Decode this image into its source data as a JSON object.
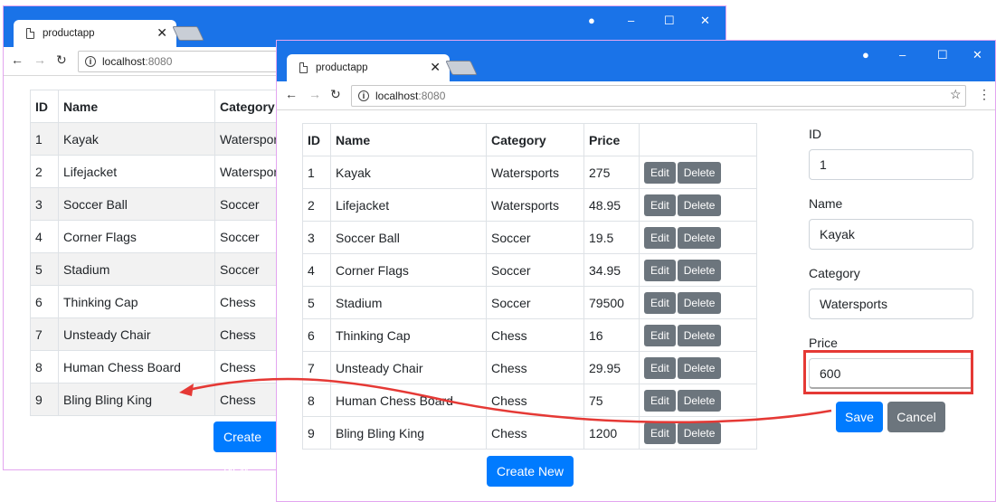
{
  "back_window": {
    "tab_title": "productapp",
    "url_host": "localhost",
    "url_port": ":8080",
    "headers": [
      "ID",
      "Name",
      "Category"
    ],
    "rows": [
      [
        "1",
        "Kayak",
        "Watersports"
      ],
      [
        "2",
        "Lifejacket",
        "Watersports"
      ],
      [
        "3",
        "Soccer Ball",
        "Soccer"
      ],
      [
        "4",
        "Corner Flags",
        "Soccer"
      ],
      [
        "5",
        "Stadium",
        "Soccer"
      ],
      [
        "6",
        "Thinking Cap",
        "Chess"
      ],
      [
        "7",
        "Unsteady Chair",
        "Chess"
      ],
      [
        "8",
        "Human Chess Board",
        "Chess"
      ],
      [
        "9",
        "Bling Bling King",
        "Chess"
      ]
    ],
    "create_label": "Create New"
  },
  "front_window": {
    "tab_title": "productapp",
    "url_host": "localhost",
    "url_port": ":8080",
    "headers": [
      "ID",
      "Name",
      "Category",
      "Price",
      ""
    ],
    "rows": [
      [
        "1",
        "Kayak",
        "Watersports",
        "275"
      ],
      [
        "2",
        "Lifejacket",
        "Watersports",
        "48.95"
      ],
      [
        "3",
        "Soccer Ball",
        "Soccer",
        "19.5"
      ],
      [
        "4",
        "Corner Flags",
        "Soccer",
        "34.95"
      ],
      [
        "5",
        "Stadium",
        "Soccer",
        "79500"
      ],
      [
        "6",
        "Thinking Cap",
        "Chess",
        "16"
      ],
      [
        "7",
        "Unsteady Chair",
        "Chess",
        "29.95"
      ],
      [
        "8",
        "Human Chess Board",
        "Chess",
        "75"
      ],
      [
        "9",
        "Bling Bling King",
        "Chess",
        "1200"
      ]
    ],
    "edit_label": "Edit",
    "delete_label": "Delete",
    "create_label": "Create New",
    "form": {
      "id_label": "ID",
      "id_value": "1",
      "name_label": "Name",
      "name_value": "Kayak",
      "category_label": "Category",
      "category_value": "Watersports",
      "price_label": "Price",
      "price_value": "600",
      "save_label": "Save",
      "cancel_label": "Cancel"
    }
  },
  "colors": {
    "titlebar": "#1a73e8",
    "primary": "#007bff",
    "secondary": "#6c757d",
    "highlight": "#e53935"
  },
  "icons": [
    "document-icon",
    "close-tab-icon",
    "new-tab-icon",
    "account-icon",
    "minimize-icon",
    "maximize-icon",
    "close-window-icon",
    "back-arrow-icon",
    "forward-arrow-icon",
    "reload-icon",
    "info-icon",
    "star-icon",
    "menu-icon"
  ]
}
